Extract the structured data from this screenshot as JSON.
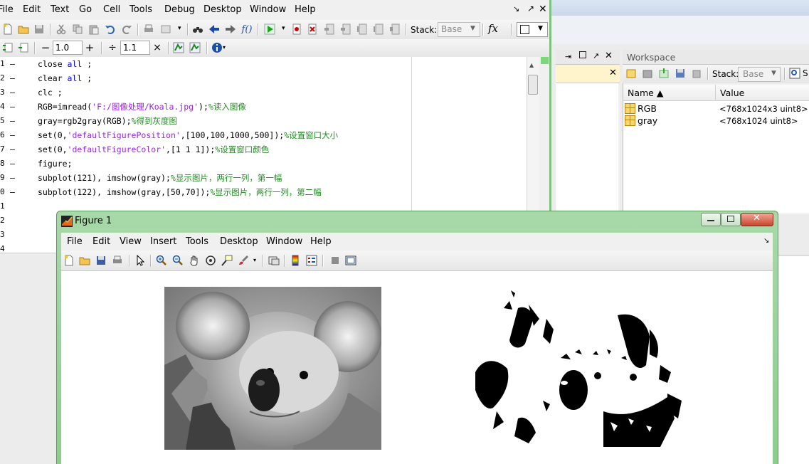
{
  "editor": {
    "menu": [
      "File",
      "Edit",
      "Text",
      "Go",
      "Cell",
      "Tools",
      "Debug",
      "Desktop",
      "Window",
      "Help"
    ],
    "toolbar": {
      "stack_label": "Stack:",
      "stack_value": "Base",
      "fx_label": "fx"
    },
    "cell_toolbar": {
      "minus": "−",
      "value1": "1.0",
      "plus": "+",
      "divide": "÷",
      "value2": "1.1",
      "times": "×"
    },
    "lines": [
      {
        "num": "1",
        "dash": "–",
        "parts": [
          [
            "",
            "close "
          ],
          [
            "kw",
            "all"
          ],
          [
            "",
            " ;"
          ]
        ]
      },
      {
        "num": "2",
        "dash": "–",
        "parts": [
          [
            "",
            "clear "
          ],
          [
            "kw",
            "all"
          ],
          [
            "",
            " ;"
          ]
        ]
      },
      {
        "num": "3",
        "dash": "–",
        "parts": [
          [
            "",
            "clc ;"
          ]
        ]
      },
      {
        "num": "4",
        "dash": "–",
        "parts": [
          [
            "",
            "RGB=imread("
          ],
          [
            "str",
            "'F:/图像处理/Koala.jpg'"
          ],
          [
            "",
            ");"
          ],
          [
            "cm",
            "%读入图像"
          ]
        ]
      },
      {
        "num": "5",
        "dash": "–",
        "parts": [
          [
            "",
            "gray=rgb2gray(RGB);"
          ],
          [
            "cm",
            "%得到灰度图"
          ]
        ]
      },
      {
        "num": "6",
        "dash": "–",
        "parts": [
          [
            "",
            "set(0,"
          ],
          [
            "str",
            "'defaultFigurePosition'"
          ],
          [
            "",
            ",[100,100,1000,500]);"
          ],
          [
            "cm",
            "%设置窗口大小"
          ]
        ]
      },
      {
        "num": "7",
        "dash": "–",
        "parts": [
          [
            "",
            "set(0,"
          ],
          [
            "str",
            "'defaultFigureColor'"
          ],
          [
            "",
            ",[1 1 1]);"
          ],
          [
            "cm",
            "%设置窗口颜色"
          ]
        ]
      },
      {
        "num": "8",
        "dash": "–",
        "parts": [
          [
            "",
            "figure;"
          ]
        ]
      },
      {
        "num": "9",
        "dash": "–",
        "parts": [
          [
            "",
            "subplot(121), imshow(gray);"
          ],
          [
            "cm",
            "%显示图片，两行一列，第一幅"
          ]
        ]
      },
      {
        "num": "0",
        "dash": "–",
        "parts": [
          [
            "",
            "subplot(122), imshow(gray,[50,70]);"
          ],
          [
            "cm",
            "%显示图片，两行一列，第二幅"
          ]
        ]
      },
      {
        "num": "1",
        "dash": "",
        "parts": []
      },
      {
        "num": "2",
        "dash": "",
        "parts": []
      },
      {
        "num": "3",
        "dash": "",
        "parts": []
      },
      {
        "num": "4",
        "dash": "",
        "parts": []
      }
    ]
  },
  "workspace": {
    "title": "Workspace",
    "stack_label": "Stack:",
    "stack_value": "Base",
    "columns": {
      "name": "Name ▲",
      "value": "Value"
    },
    "rows": [
      {
        "name": "RGB",
        "value": "<768x1024x3 uint8>"
      },
      {
        "name": "gray",
        "value": "<768x1024 uint8>"
      }
    ]
  },
  "figure": {
    "title": "Figure 1",
    "menu": [
      "File",
      "Edit",
      "View",
      "Insert",
      "Tools",
      "Desktop",
      "Window",
      "Help"
    ]
  },
  "colors": {
    "keyword": "#0000ff",
    "string": "#a020f0",
    "comment": "#228b22",
    "window_frame": "#8fcc8f"
  }
}
